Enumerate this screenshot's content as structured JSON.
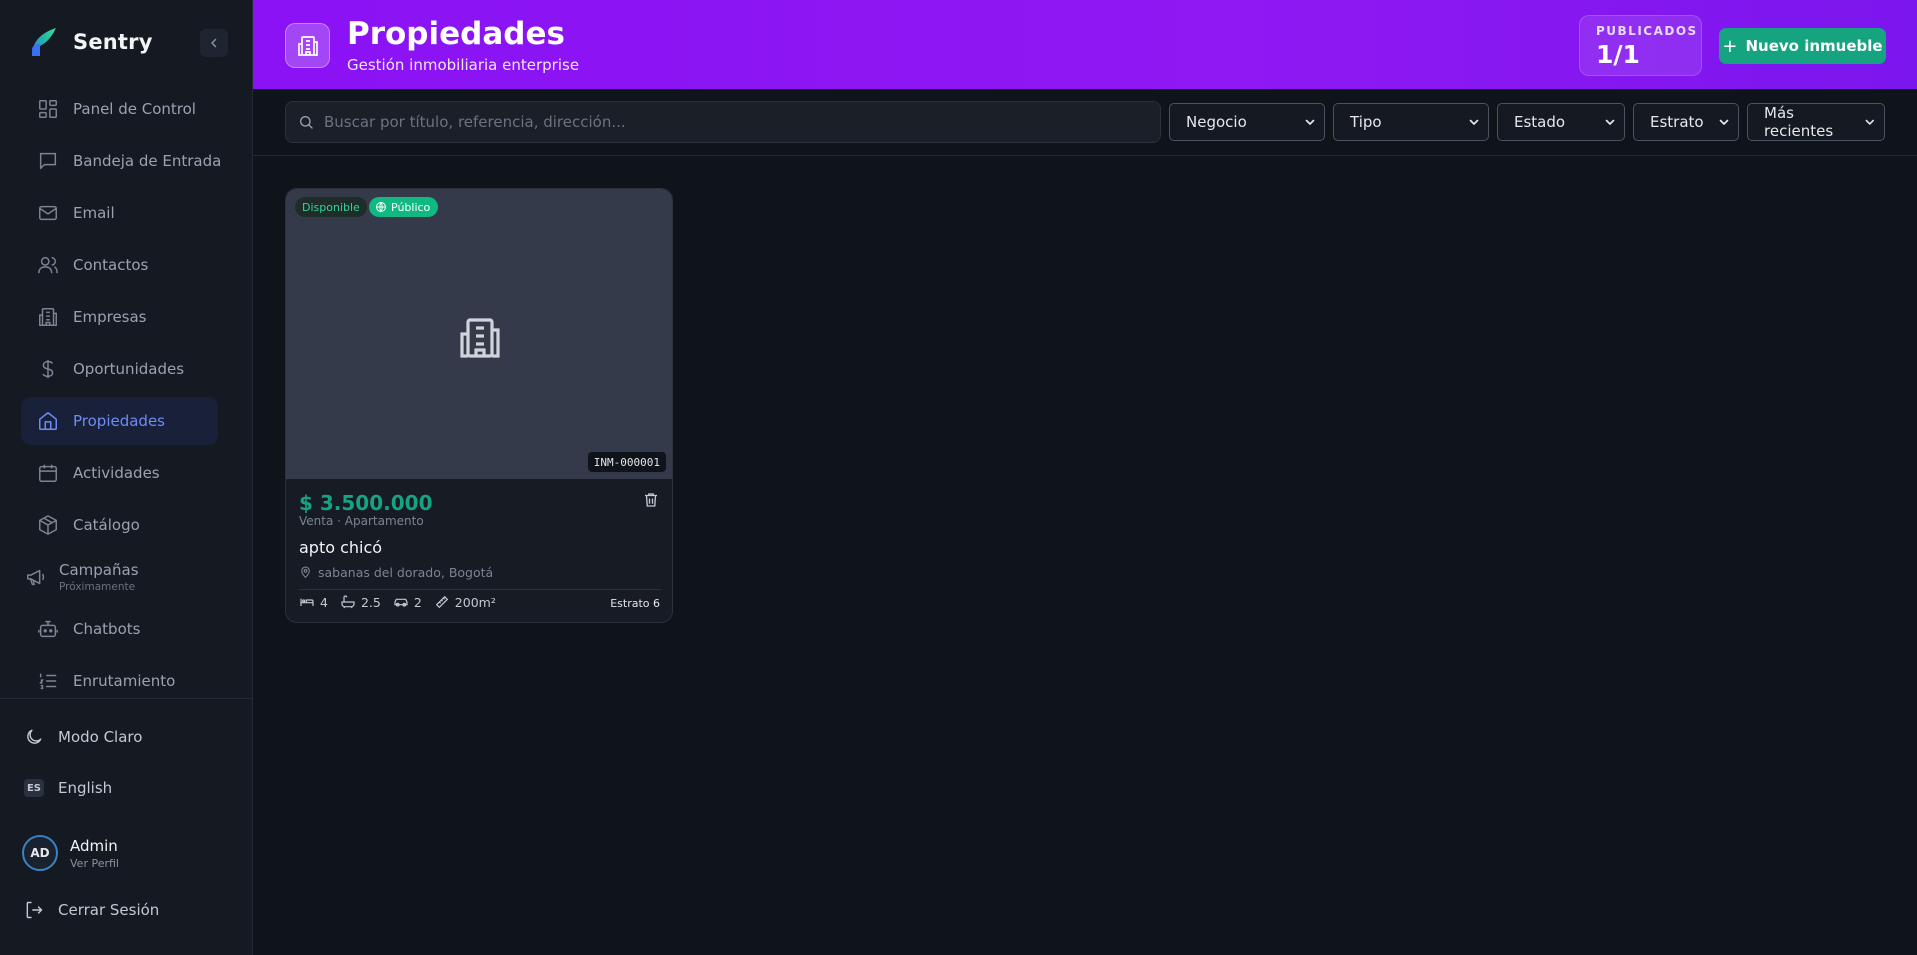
{
  "app": {
    "name": "Sentry"
  },
  "sidebar": {
    "items": [
      {
        "label": "Panel de Control"
      },
      {
        "label": "Bandeja de Entrada"
      },
      {
        "label": "Email"
      },
      {
        "label": "Contactos"
      },
      {
        "label": "Empresas"
      },
      {
        "label": "Oportunidades"
      },
      {
        "label": "Propiedades",
        "active": true
      },
      {
        "label": "Actividades"
      },
      {
        "label": "Catálogo"
      },
      {
        "label": "Campañas",
        "sub": "Próximamente"
      },
      {
        "label": "Chatbots"
      },
      {
        "label": "Enrutamiento"
      }
    ],
    "theme_toggle": "Modo Claro",
    "language_badge": "ES",
    "language_label": "English",
    "user": {
      "initials": "AD",
      "name": "Admin",
      "sub": "Ver Perfil"
    },
    "logout": "Cerrar Sesión"
  },
  "header": {
    "title": "Propiedades",
    "subtitle": "Gestión inmobiliaria enterprise",
    "published_label": "PUBLICADOS",
    "published_value": "1/1",
    "new_button": "Nuevo inmueble"
  },
  "filters": {
    "search_placeholder": "Buscar por título, referencia, dirección...",
    "search_value": "",
    "negocio": "Negocio",
    "tipo": "Tipo",
    "estado": "Estado",
    "estrato": "Estrato",
    "sort": "Más recientes"
  },
  "properties": [
    {
      "status": "Disponible",
      "visibility": "Público",
      "reference": "INM-000001",
      "price": "$ 3.500.000",
      "meta": "Venta · Apartamento",
      "title": "apto chicó",
      "location": "sabanas del dorado, Bogotá",
      "bedrooms": "4",
      "bathrooms": "2.5",
      "parking": "2",
      "area": "200m²",
      "estrato": "Estrato 6"
    }
  ],
  "colors": {
    "accent_green": "#16a37f",
    "header_purple": "#8a12f4",
    "active_nav_blue": "#6d8cf6"
  }
}
